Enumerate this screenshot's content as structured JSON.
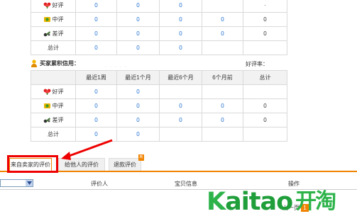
{
  "table_top": {
    "rows": [
      {
        "icon": "good-rating-icon",
        "label": "好评",
        "c1": "0",
        "c2": "0",
        "c3": "0",
        "c4": "",
        "c5": "·"
      },
      {
        "icon": "neutral-rating-icon",
        "label": "中评",
        "c1": "0",
        "c2": "0",
        "c3": "0",
        "c4": "0",
        "c5": "0"
      },
      {
        "icon": "bad-rating-icon",
        "label": "差评",
        "c1": "0",
        "c2": "0",
        "c3": "0",
        "c4": "0",
        "c5": "0"
      },
      {
        "icon": "",
        "label": "总计",
        "c1": "0",
        "c2": "0",
        "c3": "0",
        "c4": "",
        "c5": ""
      }
    ]
  },
  "buyer_credit": {
    "label": "买家累积信用：",
    "rate_label": "好评率："
  },
  "table_bottom": {
    "headers": [
      "",
      "最近1周",
      "最近1个月",
      "最近6个月",
      "6个月前",
      "总计"
    ],
    "rows": [
      {
        "icon": "good-rating-icon",
        "label": "好评",
        "c1": "0",
        "c2": "0",
        "c3": "",
        "c4": "",
        "c5": ""
      },
      {
        "icon": "neutral-rating-icon",
        "label": "中评",
        "c1": "0",
        "c2": "0",
        "c3": "0",
        "c4": "0",
        "c5": "0"
      },
      {
        "icon": "bad-rating-icon",
        "label": "差评",
        "c1": "0",
        "c2": "0",
        "c3": "0",
        "c4": "0",
        "c5": "0"
      },
      {
        "icon": "",
        "label": "总计",
        "c1": "0",
        "c2": "0",
        "c3": "",
        "c4": "",
        "c5": ""
      }
    ]
  },
  "tabs": [
    {
      "label": "来自卖家的评价",
      "active": true
    },
    {
      "label": "给他人的评价",
      "active": false
    },
    {
      "label": "退款评价",
      "active": false
    }
  ],
  "list_header": {
    "col_reviewer": "评价人",
    "col_item": "宝贝信息",
    "col_action": "操作"
  },
  "watermark": {
    "latin_k": "K",
    "latin_rest": "aitao",
    "chinese": "开淘"
  },
  "pager": {
    "prev": "上一页",
    "current": "1"
  },
  "colors": {
    "accent": "#f08300",
    "link": "#1f6fd1",
    "highlight": "#e00000",
    "logo_green": "#2db34a"
  }
}
